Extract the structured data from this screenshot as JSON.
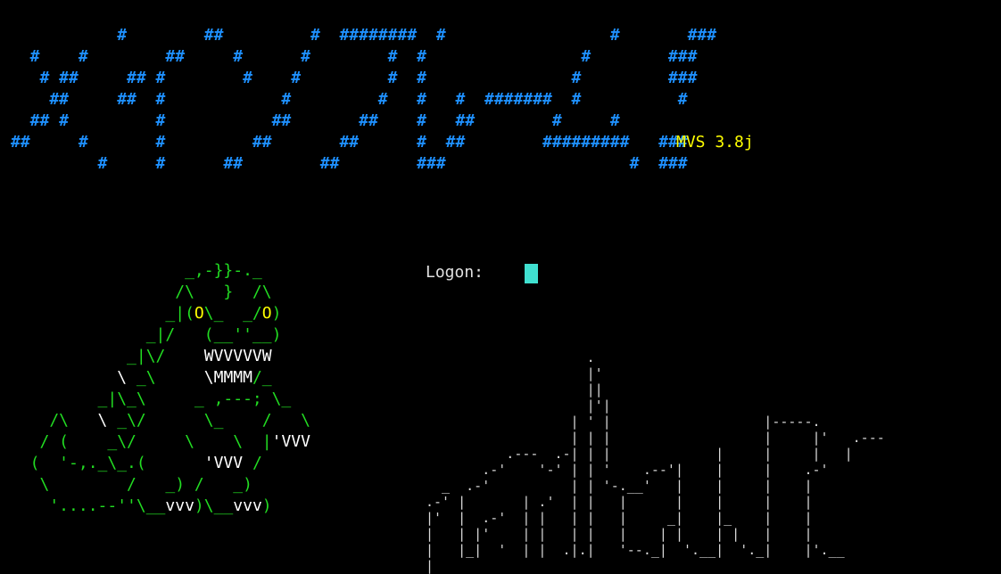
{
  "colors": {
    "background": "#000000",
    "banner": "#1e90ff",
    "version": "#ffff00",
    "prompt": "#e0e0e0",
    "cursor": "#40e0d0",
    "monster_body": "#22dd22",
    "monster_eyes": "#ffff00",
    "monster_teeth": "#ffffff",
    "skyline": "#d8d8d8"
  },
  "banner_art": "           #        ##         #  ########  #                 #       ###\n  #    #        ##     #      #        #  #                #        ###\n   # ##     ## #        #    #         #  #               #         ###\n    ##     ##  #            #         #   #   #  #######  #          #\n  ## #         #           ##       ##    #   ##        #     #\n##     #       #         ##       ##      #  ##        #########   ###\n         #     #      ##        ##        ###                   #  ###",
  "version": "MVS 3.8j",
  "logon": {
    "label": "Logon:"
  },
  "monster_lines": [
    [
      [
        "                  _,-}}-._",
        "body"
      ]
    ],
    [
      [
        "                 /\\   }  /\\",
        "body"
      ]
    ],
    [
      [
        "                _|(",
        "body"
      ],
      [
        "O",
        "eyes"
      ],
      [
        "\\_  _/",
        "body"
      ],
      [
        "O",
        "eyes"
      ],
      [
        ")",
        "body"
      ]
    ],
    [
      [
        "              _|/   (__''__)",
        "body"
      ]
    ],
    [
      [
        "            _|\\/    ",
        "body"
      ],
      [
        "WVVVVVW",
        "teeth"
      ]
    ],
    [
      [
        "           ",
        "body"
      ],
      [
        "\\ ",
        "teeth"
      ],
      [
        "_\\     ",
        "body"
      ],
      [
        "\\",
        "teeth"
      ],
      [
        "MMMM",
        "teeth"
      ],
      [
        "/_",
        "body"
      ]
    ],
    [
      [
        "         _|\\_\\     _ ,---; \\_",
        "body"
      ]
    ],
    [
      [
        "    /\\   ",
        "body"
      ],
      [
        "\\ ",
        "teeth"
      ],
      [
        "_\\/      \\_    /   \\",
        "body"
      ]
    ],
    [
      [
        "   / (    _\\/     \\    \\  |",
        "body"
      ],
      [
        "'VVV",
        "teeth"
      ]
    ],
    [
      [
        "  (  '-,._\\_.(      ",
        "body"
      ],
      [
        "'VVV",
        "teeth"
      ],
      [
        " /",
        "body"
      ]
    ],
    [
      [
        "   \\        /   _) /   _)",
        "body"
      ]
    ],
    [
      [
        "    '....--''\\__",
        "body"
      ],
      [
        "vvv",
        "teeth"
      ],
      [
        ")\\__",
        "body"
      ],
      [
        "vvv",
        "teeth"
      ],
      [
        ")",
        "body"
      ]
    ]
  ],
  "skyline_art": "                    .\n                    |'\n                    ||\n                    |'|\n                  | ' |                   |-----.\n                  | | |                   |     |'   .---\n          .---  .-| | |             |     |     |   |\n       .-'    '-' | | '    .--'|    |     |    .-'\n  _  .-'          | | '-.__'   |    |     |    |\n.-' |       | .'  | |   |      |    |     |    |\n|'  |  .-'  | |   | |   |     _|    |_    |    |\n|   | |'    | |   | |   |    | |    | |   |    |\n|   |_|  '  | |  .|.|   '--._|  '.__|  '._|    |'.__\n|"
}
